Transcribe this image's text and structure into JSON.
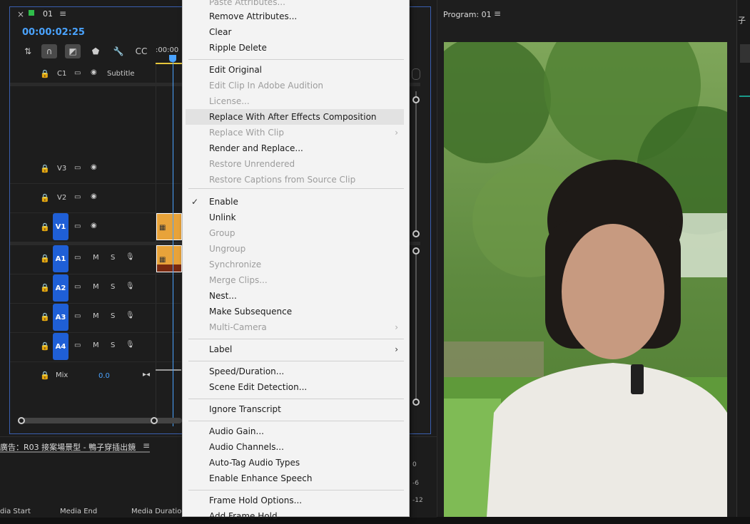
{
  "timeline": {
    "sequence_name": "01",
    "timecode": "00:00:02:25",
    "ruler_label": ":00:00",
    "subtitle_track": {
      "id": "C1",
      "label": "Subtitle"
    },
    "video_tracks": [
      {
        "id": "V3",
        "active": false
      },
      {
        "id": "V2",
        "active": false
      },
      {
        "id": "V1",
        "active": true
      }
    ],
    "audio_tracks": [
      {
        "id": "A1",
        "m": "M",
        "s": "S"
      },
      {
        "id": "A2",
        "m": "M",
        "s": "S"
      },
      {
        "id": "A3",
        "m": "M",
        "s": "S"
      },
      {
        "id": "A4",
        "m": "M",
        "s": "S"
      }
    ],
    "mix": {
      "label": "Mix",
      "value": "0.0"
    }
  },
  "bottom_panel": {
    "title": "廣告：R03 接案場景型 - 鴨子穿插出鏡",
    "columns": [
      "dia Start",
      "Media End",
      "Media Duration"
    ],
    "meter_labels": [
      "0",
      "-6",
      "-12"
    ]
  },
  "program": {
    "title": "Program: 01"
  },
  "right_strip": {
    "text": "子"
  },
  "context_menu": {
    "items": [
      {
        "label": "Paste Attributes...",
        "enabled": false
      },
      {
        "label": "Remove Attributes...",
        "enabled": true
      },
      {
        "label": "Clear",
        "enabled": true
      },
      {
        "label": "Ripple Delete",
        "enabled": true
      },
      {
        "label": "Edit Original",
        "enabled": true
      },
      {
        "label": "Edit Clip In Adobe Audition",
        "enabled": false
      },
      {
        "label": "License...",
        "enabled": false
      },
      {
        "label": "Replace With After Effects Composition",
        "enabled": true,
        "highlighted": true
      },
      {
        "label": "Replace With Clip",
        "enabled": false,
        "submenu": true
      },
      {
        "label": "Render and Replace...",
        "enabled": true
      },
      {
        "label": "Restore Unrendered",
        "enabled": false
      },
      {
        "label": "Restore Captions from Source Clip",
        "enabled": false
      },
      {
        "label": "Enable",
        "enabled": true,
        "checked": true
      },
      {
        "label": "Unlink",
        "enabled": true
      },
      {
        "label": "Group",
        "enabled": false
      },
      {
        "label": "Ungroup",
        "enabled": false
      },
      {
        "label": "Synchronize",
        "enabled": false
      },
      {
        "label": "Merge Clips...",
        "enabled": false
      },
      {
        "label": "Nest...",
        "enabled": true
      },
      {
        "label": "Make Subsequence",
        "enabled": true
      },
      {
        "label": "Multi-Camera",
        "enabled": false,
        "submenu": true
      },
      {
        "label": "Label",
        "enabled": true,
        "submenu": true
      },
      {
        "label": "Speed/Duration...",
        "enabled": true
      },
      {
        "label": "Scene Edit Detection...",
        "enabled": true
      },
      {
        "label": "Ignore Transcript",
        "enabled": true
      },
      {
        "label": "Audio Gain...",
        "enabled": true
      },
      {
        "label": "Audio Channels...",
        "enabled": true
      },
      {
        "label": "Auto-Tag Audio Types",
        "enabled": true
      },
      {
        "label": "Enable Enhance Speech",
        "enabled": true
      },
      {
        "label": "Frame Hold Options...",
        "enabled": true
      },
      {
        "label": "Add Frame Hold",
        "enabled": true
      }
    ]
  },
  "colors": {
    "accent_blue": "#1f5fd6",
    "timecode_blue": "#4aa3ff",
    "clip_orange": "#e8a33a",
    "menu_bg": "#f3f3f3"
  }
}
